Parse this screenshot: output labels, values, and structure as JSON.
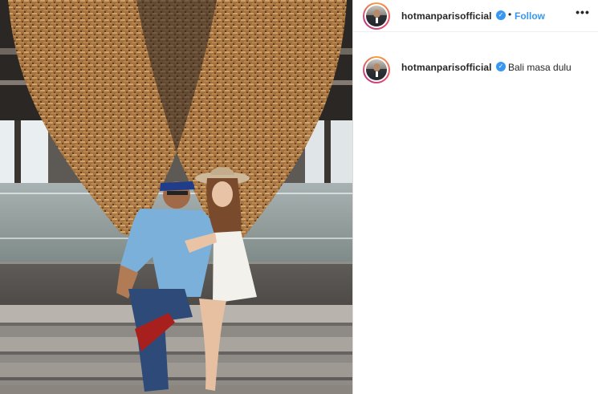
{
  "post": {
    "author": {
      "username": "hotmanparisofficial",
      "verified": true,
      "verified_glyph": "✓"
    },
    "header": {
      "separator": "•",
      "follow_label": "Follow",
      "more_label": "•••"
    },
    "caption": {
      "username": "hotmanparisofficial",
      "text": "Bali masa dulu"
    }
  },
  "colors": {
    "accent": "#3897f0",
    "text": "#262626",
    "border": "#dbdbdb"
  },
  "icons": [
    "verified-badge-icon",
    "more-options-icon"
  ]
}
